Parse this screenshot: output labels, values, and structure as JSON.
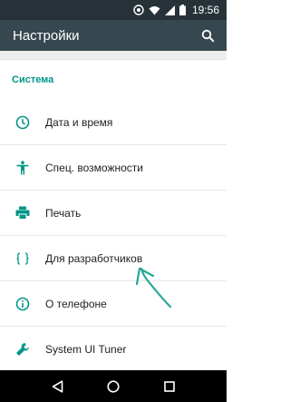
{
  "status_bar": {
    "time": "19:56",
    "icons": [
      "sync-icon",
      "wifi-icon",
      "signal-icon",
      "battery-icon"
    ]
  },
  "app_bar": {
    "title": "Настройки",
    "search_icon": "search-icon"
  },
  "section": {
    "title": "Система"
  },
  "rows": [
    {
      "label": "Дата и время",
      "icon": "clock-icon"
    },
    {
      "label": "Спец. возможности",
      "icon": "accessibility-icon"
    },
    {
      "label": "Печать",
      "icon": "printer-icon"
    },
    {
      "label": "Для разработчиков",
      "icon": "code-braces-icon"
    },
    {
      "label": "О телефоне",
      "icon": "info-icon"
    },
    {
      "label": "System UI Tuner",
      "icon": "wrench-icon"
    }
  ],
  "nav_bar": {
    "buttons": [
      "back-icon",
      "home-icon",
      "recents-icon"
    ]
  },
  "colors": {
    "status_bar": "#263238",
    "app_bar": "#37474f",
    "accent": "#009688",
    "annotation_arrow": "#26a69a"
  }
}
